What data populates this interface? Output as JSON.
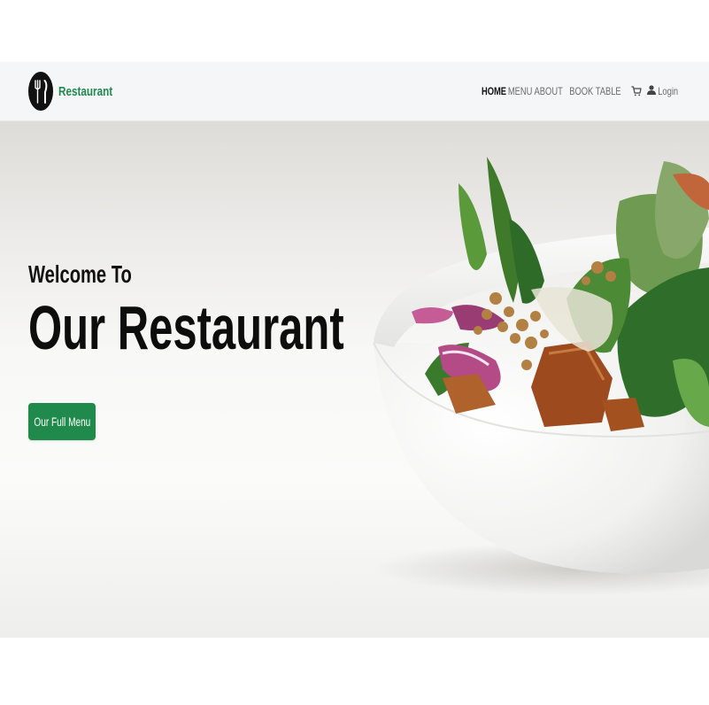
{
  "header": {
    "brand_name": "Restaurant",
    "nav": {
      "home": "HOME",
      "menu": "MENU",
      "about": "ABOUT",
      "book_table": "BOOK TABLE",
      "login": "Login"
    }
  },
  "hero": {
    "welcome": "Welcome To",
    "headline": "Our Restaurant",
    "cta_label": "Our Full Menu",
    "image_alt": "Salad bowl"
  },
  "colors": {
    "accent": "#1f8a4c",
    "navbar_bg": "#f5f6f8",
    "text_dark": "#111111",
    "nav_text": "#6b6b6b"
  },
  "icons": {
    "logo": "fork-knife-icon",
    "cart": "cart-icon",
    "user": "user-icon"
  }
}
